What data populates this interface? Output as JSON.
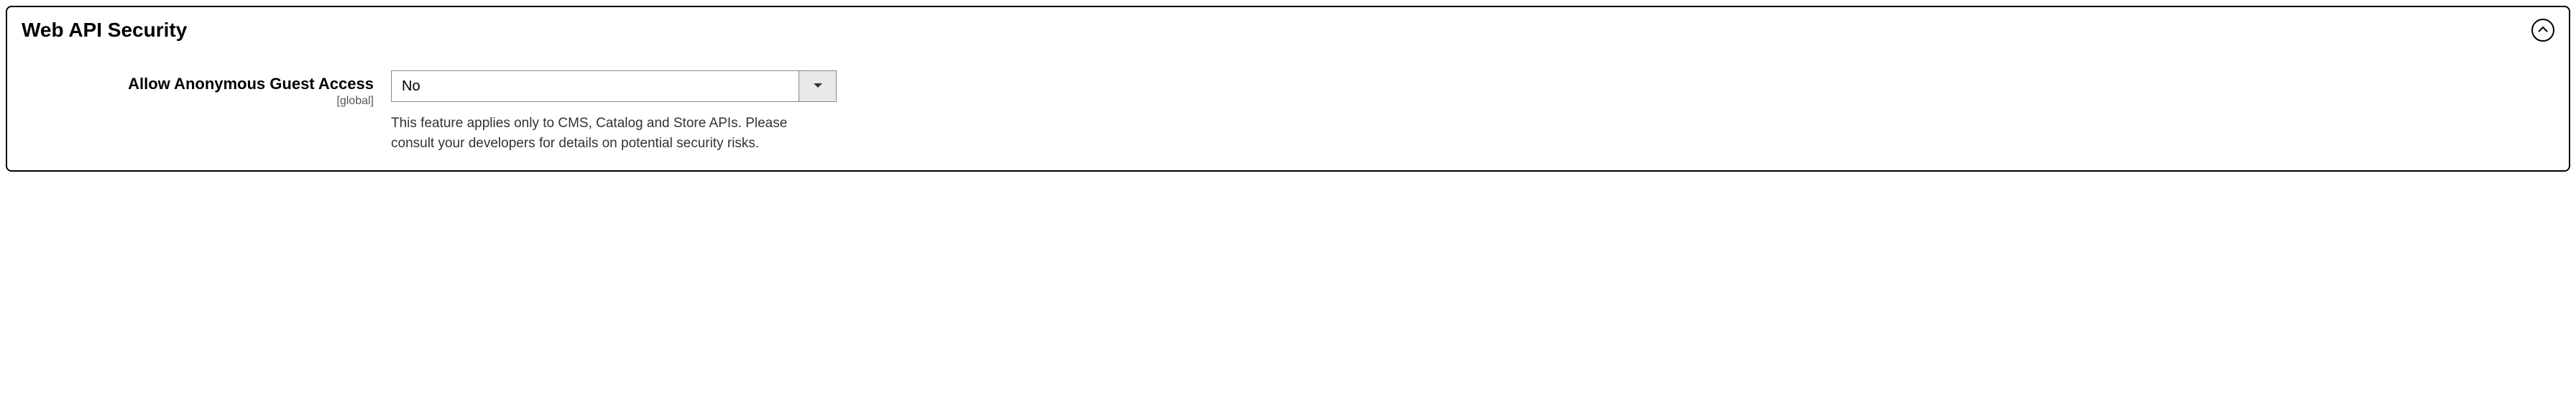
{
  "section": {
    "title": "Web API Security"
  },
  "field": {
    "label": "Allow Anonymous Guest Access",
    "scope": "[global]",
    "value": "No",
    "note": "This feature applies only to CMS, Catalog and Store APIs. Please consult your developers for details on potential security risks."
  }
}
